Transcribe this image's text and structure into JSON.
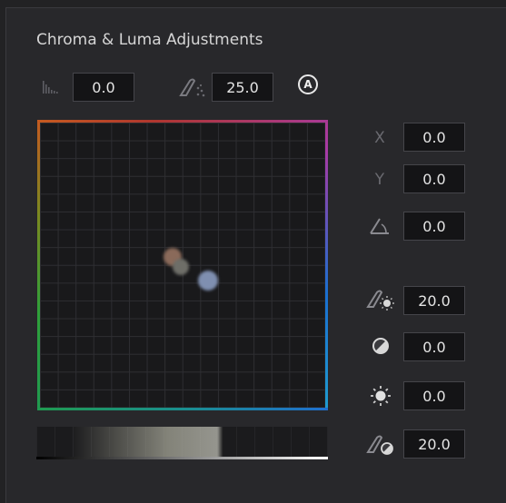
{
  "panel": {
    "title": "Chroma & Luma Adjustments",
    "top_row": {
      "histogram_value": "0.0",
      "softness_value": "25.0",
      "auto_badge": "A"
    },
    "fields": {
      "x_label": "X",
      "x_value": "0.0",
      "y_label": "Y",
      "y_value": "0.0",
      "angle_value": "0.0",
      "chroma_gain_value": "20.0",
      "contrast_value": "0.0",
      "brightness_value": "0.0",
      "luma_gain_value": "20.0"
    }
  }
}
